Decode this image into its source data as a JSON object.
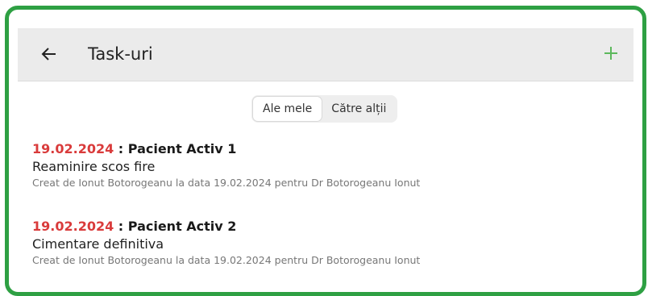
{
  "appbar": {
    "title": "Task-uri",
    "back_icon": "arrow-left-icon",
    "add_icon": "plus-icon"
  },
  "tabs": [
    {
      "label": "Ale mele",
      "active": true
    },
    {
      "label": "Către alții",
      "active": false
    }
  ],
  "tasks": [
    {
      "date": "19.02.2024",
      "separator": " : ",
      "patient": "Pacient Activ 1",
      "title": "Reaminire scos fire",
      "meta": "Creat de Ionut Botorogeanu la data 19.02.2024 pentru Dr Botorogeanu Ionut"
    },
    {
      "date": "19.02.2024",
      "separator": " : ",
      "patient": "Pacient Activ 2",
      "title": "Cimentare definitiva",
      "meta": "Creat de Ionut Botorogeanu la data 19.02.2024 pentru Dr Botorogeanu Ionut"
    }
  ],
  "colors": {
    "frame": "#2ea043",
    "date": "#d93b3b",
    "add_icon": "#5cb85c",
    "appbar": "#ebebeb"
  }
}
